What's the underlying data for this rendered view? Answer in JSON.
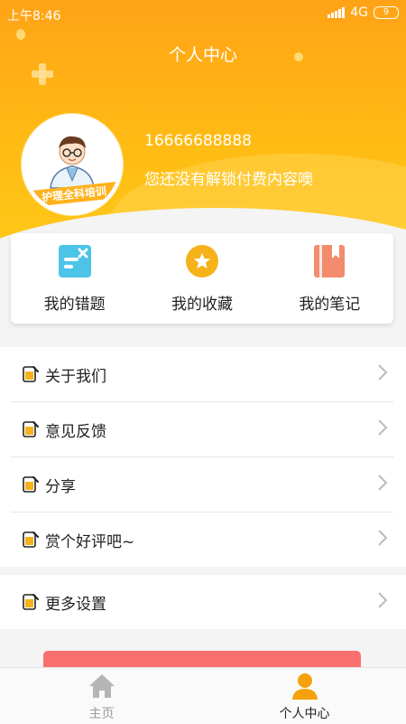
{
  "status_bar": {
    "time": "上午8:46",
    "network": "4G",
    "battery": "9"
  },
  "header": {
    "title": "个人中心"
  },
  "profile": {
    "avatar_caption": "护理全科培训",
    "phone": "16666688888",
    "hint": "您还没有解锁付费内容噢"
  },
  "quick_actions": [
    {
      "label": "我的错题",
      "icon": "wrong-questions-icon",
      "color": "#4cc4e8"
    },
    {
      "label": "我的收藏",
      "icon": "star-icon",
      "color": "#f5b21a"
    },
    {
      "label": "我的笔记",
      "icon": "notebook-icon",
      "color": "#f28c6c"
    }
  ],
  "menu": [
    {
      "label": "关于我们"
    },
    {
      "label": "意见反馈"
    },
    {
      "label": "分享"
    },
    {
      "label": "赏个好评吧~"
    }
  ],
  "menu2": [
    {
      "label": "更多设置"
    }
  ],
  "tabbar": {
    "items": [
      {
        "label": "主页",
        "icon": "home-icon",
        "active": false
      },
      {
        "label": "个人中心",
        "icon": "user-icon",
        "active": true
      }
    ]
  },
  "colors": {
    "accent": "#ffa316",
    "active_tab": "#f5a10e",
    "inactive_tab": "#999999",
    "logout": "#fb6f6e"
  }
}
